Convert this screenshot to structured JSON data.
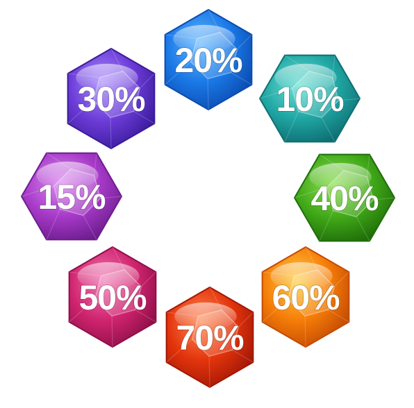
{
  "gems": [
    {
      "label": "20%",
      "color": "#1a78e6",
      "light": "#61b7ff",
      "dark": "#0b4cb0"
    },
    {
      "label": "10%",
      "color": "#1fa6a3",
      "light": "#6fe1d6",
      "dark": "#0f6f73"
    },
    {
      "label": "40%",
      "color": "#40a818",
      "light": "#8fe055",
      "dark": "#1f6e09"
    },
    {
      "label": "60%",
      "color": "#f57d08",
      "light": "#ffce45",
      "dark": "#c44b03"
    },
    {
      "label": "70%",
      "color": "#e3340c",
      "light": "#ff8a55",
      "dark": "#a31806"
    },
    {
      "label": "50%",
      "color": "#d0246f",
      "light": "#f27ab5",
      "dark": "#8f0f48"
    },
    {
      "label": "15%",
      "color": "#a73ac8",
      "light": "#dc8cf0",
      "dark": "#6d1d8f"
    },
    {
      "label": "30%",
      "color": "#6b3bd6",
      "light": "#a98cff",
      "dark": "#3b1b9c"
    }
  ]
}
